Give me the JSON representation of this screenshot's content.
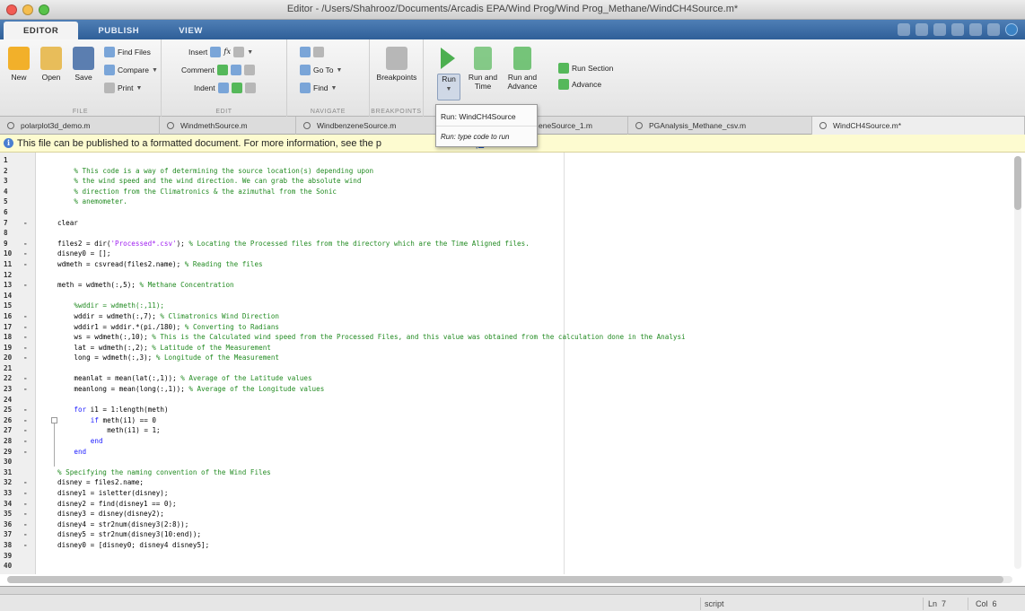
{
  "window": {
    "title": "Editor - /Users/Shahrooz/Documents/Arcadis EPA/Wind Prog/Wind Prog_Methane/WindCH4Source.m*"
  },
  "ribbon_tabs": [
    {
      "label": "EDITOR",
      "active": true
    },
    {
      "label": "PUBLISH",
      "active": false
    },
    {
      "label": "VIEW",
      "active": false
    }
  ],
  "ribbon": {
    "file": {
      "new": "New",
      "open": "Open",
      "save": "Save",
      "find_files": "Find Files",
      "compare": "Compare",
      "print": "Print",
      "group": "FILE"
    },
    "edit": {
      "insert": "Insert",
      "comment": "Comment",
      "indent": "Indent",
      "fx": "fx",
      "group": "EDIT"
    },
    "navigate": {
      "goto": "Go To",
      "find": "Find",
      "group": "NAVIGATE"
    },
    "breakpoints": {
      "label": "Breakpoints",
      "group": "BREAKPOINTS"
    },
    "run": {
      "run": "Run",
      "run_time": "Run and Time",
      "run_advance": "Run and Advance",
      "run_section": "Run Section",
      "advance": "Advance"
    }
  },
  "run_menu": {
    "item1": "Run: WindCH4Source",
    "item2": "Run: type code to run"
  },
  "doc_tabs": [
    {
      "label": "polarplot3d_demo.m",
      "active": false
    },
    {
      "label": "WindmethSource.m",
      "active": false
    },
    {
      "label": "WindbenzeneSource.m",
      "active": false
    },
    {
      "label": "eneSource_1.m",
      "active": false
    },
    {
      "label": "PGAnalysis_Methane_csv.m",
      "active": false
    },
    {
      "label": "WindCH4Source.m*",
      "active": true
    }
  ],
  "infobar": {
    "text": "This file can be published to a formatted document. For more information, see the p",
    "link": "p."
  },
  "editor": {
    "lines": [
      {
        "n": "1",
        "bp": "",
        "indent": 0,
        "parts": []
      },
      {
        "n": "2",
        "bp": "",
        "indent": 4,
        "parts": [
          {
            "t": "% This code is a way of determining the source location(s) depending upon",
            "c": "cm"
          }
        ]
      },
      {
        "n": "3",
        "bp": "",
        "indent": 4,
        "parts": [
          {
            "t": "% the wind speed and the wind direction. We can grab the absolute wind",
            "c": "cm"
          }
        ]
      },
      {
        "n": "4",
        "bp": "",
        "indent": 4,
        "parts": [
          {
            "t": "% direction from the Climatronics & the azimuthal from the Sonic",
            "c": "cm"
          }
        ]
      },
      {
        "n": "5",
        "bp": "",
        "indent": 4,
        "parts": [
          {
            "t": "% anemometer.",
            "c": "cm"
          }
        ]
      },
      {
        "n": "6",
        "bp": "",
        "indent": 0,
        "parts": []
      },
      {
        "n": "7",
        "bp": "-",
        "indent": 0,
        "parts": [
          {
            "t": "clear",
            "c": "pl"
          }
        ]
      },
      {
        "n": "8",
        "bp": "",
        "indent": 0,
        "parts": []
      },
      {
        "n": "9",
        "bp": "-",
        "indent": 0,
        "parts": [
          {
            "t": "files2 = dir(",
            "c": "pl"
          },
          {
            "t": "'Processed*.csv'",
            "c": "str"
          },
          {
            "t": "); ",
            "c": "pl"
          },
          {
            "t": "% Locating the Processed files from the directory which are the Time Aligned files.",
            "c": "cm"
          }
        ]
      },
      {
        "n": "10",
        "bp": "-",
        "indent": 0,
        "parts": [
          {
            "t": "disney0 = [];",
            "c": "pl"
          }
        ]
      },
      {
        "n": "11",
        "bp": "-",
        "indent": 0,
        "parts": [
          {
            "t": "wdmeth = csvread(files2.name); ",
            "c": "pl"
          },
          {
            "t": "% Reading the files",
            "c": "cm"
          }
        ]
      },
      {
        "n": "12",
        "bp": "",
        "indent": 0,
        "parts": []
      },
      {
        "n": "13",
        "bp": "-",
        "indent": 0,
        "parts": [
          {
            "t": "meth = wdmeth(:,5); ",
            "c": "pl"
          },
          {
            "t": "% Methane Concentration",
            "c": "cm"
          }
        ]
      },
      {
        "n": "14",
        "bp": "",
        "indent": 0,
        "parts": []
      },
      {
        "n": "15",
        "bp": "",
        "indent": 4,
        "parts": [
          {
            "t": "%wddir = wdmeth(:,11);",
            "c": "cm"
          }
        ]
      },
      {
        "n": "16",
        "bp": "-",
        "indent": 4,
        "parts": [
          {
            "t": "wddir = wdmeth(:,7); ",
            "c": "pl"
          },
          {
            "t": "% Climatronics Wind Direction",
            "c": "cm"
          }
        ]
      },
      {
        "n": "17",
        "bp": "-",
        "indent": 4,
        "parts": [
          {
            "t": "wddir1 = wddir.*(pi./180); ",
            "c": "pl"
          },
          {
            "t": "% Converting to Radians",
            "c": "cm"
          }
        ]
      },
      {
        "n": "18",
        "bp": "-",
        "indent": 4,
        "parts": [
          {
            "t": "ws = wdmeth(:,10); ",
            "c": "pl"
          },
          {
            "t": "% This is the Calculated wind speed from the Processed Files, and this value was obtained from the calculation done in the Analysi",
            "c": "cm"
          }
        ]
      },
      {
        "n": "19",
        "bp": "-",
        "indent": 4,
        "parts": [
          {
            "t": "lat = wdmeth(:,2); ",
            "c": "pl"
          },
          {
            "t": "% Latitude of the Measurement",
            "c": "cm"
          }
        ]
      },
      {
        "n": "20",
        "bp": "-",
        "indent": 4,
        "parts": [
          {
            "t": "long = wdmeth(:,3); ",
            "c": "pl"
          },
          {
            "t": "% Longitude of the Measurement",
            "c": "cm"
          }
        ]
      },
      {
        "n": "21",
        "bp": "",
        "indent": 0,
        "parts": []
      },
      {
        "n": "22",
        "bp": "-",
        "indent": 4,
        "parts": [
          {
            "t": "meanlat = mean(lat(:,1)); ",
            "c": "pl"
          },
          {
            "t": "% Average of the Latitude values",
            "c": "cm"
          }
        ]
      },
      {
        "n": "23",
        "bp": "-",
        "indent": 4,
        "parts": [
          {
            "t": "meanlong = mean(long(:,1)); ",
            "c": "pl"
          },
          {
            "t": "% Average of the Longitude values",
            "c": "cm"
          }
        ]
      },
      {
        "n": "24",
        "bp": "",
        "indent": 0,
        "parts": []
      },
      {
        "n": "25",
        "bp": "-",
        "indent": 4,
        "parts": [
          {
            "t": "for",
            "c": "kw"
          },
          {
            "t": " i1 = 1:length(meth)",
            "c": "pl"
          }
        ]
      },
      {
        "n": "26",
        "bp": "-",
        "indent": 8,
        "parts": [
          {
            "t": "if",
            "c": "kw"
          },
          {
            "t": " meth(i1) == 0",
            "c": "pl"
          }
        ]
      },
      {
        "n": "27",
        "bp": "-",
        "indent": 12,
        "parts": [
          {
            "t": "meth(i1) = 1;",
            "c": "pl"
          }
        ]
      },
      {
        "n": "28",
        "bp": "-",
        "indent": 8,
        "parts": [
          {
            "t": "end",
            "c": "kw"
          }
        ]
      },
      {
        "n": "29",
        "bp": "-",
        "indent": 4,
        "parts": [
          {
            "t": "end",
            "c": "kw"
          }
        ]
      },
      {
        "n": "30",
        "bp": "",
        "indent": 0,
        "parts": []
      },
      {
        "n": "31",
        "bp": "",
        "indent": 0,
        "parts": [
          {
            "t": "% Specifying the naming convention of the Wind Files",
            "c": "cm"
          }
        ]
      },
      {
        "n": "32",
        "bp": "-",
        "indent": 0,
        "parts": [
          {
            "t": "disney = files2.name;",
            "c": "pl"
          }
        ]
      },
      {
        "n": "33",
        "bp": "-",
        "indent": 0,
        "parts": [
          {
            "t": "disney1 = isletter(disney);",
            "c": "pl"
          }
        ]
      },
      {
        "n": "34",
        "bp": "-",
        "indent": 0,
        "parts": [
          {
            "t": "disney2 = find(disney1 == 0);",
            "c": "pl"
          }
        ]
      },
      {
        "n": "35",
        "bp": "-",
        "indent": 0,
        "parts": [
          {
            "t": "disney3 = disney(disney2);",
            "c": "pl"
          }
        ]
      },
      {
        "n": "36",
        "bp": "-",
        "indent": 0,
        "parts": [
          {
            "t": "disney4 = str2num(disney3(2:8));",
            "c": "pl"
          }
        ]
      },
      {
        "n": "37",
        "bp": "-",
        "indent": 0,
        "parts": [
          {
            "t": "disney5 = str2num(disney3(10:end));",
            "c": "pl"
          }
        ]
      },
      {
        "n": "38",
        "bp": "-",
        "indent": 0,
        "parts": [
          {
            "t": "disney0 = [disney0; disney4 disney5];",
            "c": "pl"
          }
        ]
      },
      {
        "n": "39",
        "bp": "",
        "indent": 0,
        "parts": []
      },
      {
        "n": "40",
        "bp": "",
        "indent": 0,
        "parts": []
      }
    ]
  },
  "status": {
    "mode": "script",
    "ln_label": "Ln",
    "ln": "7",
    "col_label": "Col",
    "col": "6"
  }
}
